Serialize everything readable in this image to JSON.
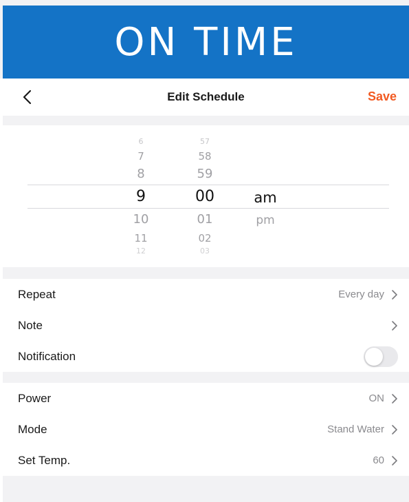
{
  "banner": {
    "title": "ON TIME"
  },
  "nav": {
    "title": "Edit Schedule",
    "save_label": "Save",
    "back_icon": "chevron-left-icon"
  },
  "picker": {
    "hours": [
      "6",
      "7",
      "8",
      "9",
      "10",
      "11",
      "12"
    ],
    "minutes": [
      "57",
      "58",
      "59",
      "00",
      "01",
      "02",
      "03"
    ],
    "periods": [
      "am",
      "pm"
    ],
    "selected": {
      "hour": "9",
      "minute": "00",
      "period": "am"
    }
  },
  "settings": {
    "repeat": {
      "label": "Repeat",
      "value": "Every day"
    },
    "note": {
      "label": "Note",
      "value": ""
    },
    "notification": {
      "label": "Notification",
      "enabled": false
    }
  },
  "device": {
    "power": {
      "label": "Power",
      "value": "ON"
    },
    "mode": {
      "label": "Mode",
      "value": "Stand Water"
    },
    "temp": {
      "label": "Set Temp.",
      "value": "60"
    }
  },
  "colors": {
    "banner": "#1473c6",
    "accent": "#f25a22",
    "background": "#f2f2f4"
  }
}
